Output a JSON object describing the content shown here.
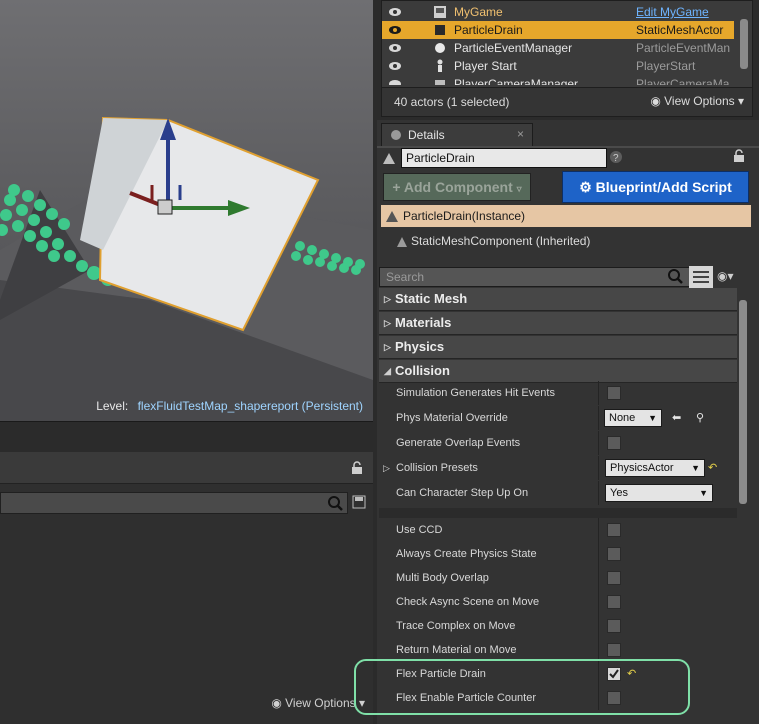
{
  "viewport": {
    "level_prefix": "Level:",
    "level_name": "flexFluidTestMap_shapereport (Persistent)"
  },
  "lower_left": {
    "view_options": "View Options"
  },
  "outliner": {
    "rows": [
      {
        "label": "MyGame",
        "type": "Edit MyGame",
        "icon": "game-icon",
        "selected": false
      },
      {
        "label": "ParticleDrain",
        "type": "StaticMeshActor",
        "icon": "static-mesh-icon",
        "selected": true
      },
      {
        "label": "ParticleEventManager",
        "type": "ParticleEventMan",
        "icon": "sphere-icon",
        "selected": false
      },
      {
        "label": "Player Start",
        "type": "PlayerStart",
        "icon": "player-start-icon",
        "selected": false
      },
      {
        "label": "PlayerCameraManager",
        "type": "PlayerCameraMa",
        "icon": "camera-icon",
        "selected": false
      }
    ],
    "count": "40 actors (1 selected)",
    "view_options": "View Options"
  },
  "details": {
    "tab_label": "Details",
    "actor_name": "ParticleDrain",
    "add_component": "Add Component",
    "blueprint_script": "Blueprint/Add Script",
    "component_instance": "ParticleDrain(Instance)",
    "component_inherited": "StaticMeshComponent (Inherited)",
    "search_placeholder": "Search",
    "categories": {
      "static_mesh": "Static Mesh",
      "materials": "Materials",
      "physics": "Physics",
      "collision": "Collision"
    },
    "props": {
      "sim_hit": "Simulation Generates Hit Events",
      "phys_mat": "Phys Material Override",
      "phys_mat_value": "None",
      "gen_overlap": "Generate Overlap Events",
      "presets": "Collision Presets",
      "presets_value": "PhysicsActor",
      "step_up": "Can Character Step Up On",
      "step_up_value": "Yes",
      "use_ccd": "Use CCD",
      "always_create": "Always Create Physics State",
      "multi_body": "Multi Body Overlap",
      "check_async": "Check Async Scene on Move",
      "trace_complex": "Trace Complex on Move",
      "return_material": "Return Material on Move",
      "flex_drain": "Flex Particle Drain",
      "flex_drain_checked": true,
      "flex_counter": "Flex Enable Particle Counter"
    }
  },
  "colors": {
    "selection": "#e6a72b",
    "blueprint_button": "#1e63c8",
    "highlight_ring": "#7fe0a8",
    "link": "#9fd4ff"
  }
}
